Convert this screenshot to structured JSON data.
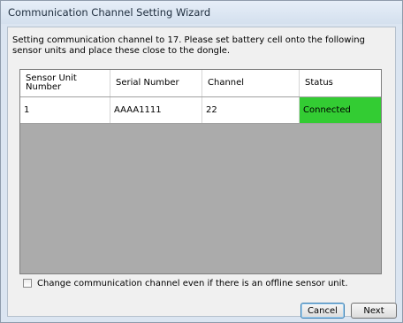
{
  "window": {
    "title": "Communication Channel Setting Wizard"
  },
  "instructions": "Setting communication channel to 17. Please set battery cell onto the following sensor units and place these close to the dongle.",
  "table": {
    "columns": [
      "Sensor Unit Number",
      "Serial Number",
      "Channel",
      "Status"
    ],
    "rows": [
      {
        "sensor_unit_number": "1",
        "serial_number": "AAAA1111",
        "channel": "22",
        "status": "Connected"
      }
    ]
  },
  "colors": {
    "status_connected": "#33cc33",
    "grid_empty_area": "#ababab"
  },
  "offline_option": {
    "label": "Change communication channel even if there is an offline sensor unit.",
    "checked": false
  },
  "buttons": {
    "cancel": "Cancel",
    "next": "Next"
  }
}
